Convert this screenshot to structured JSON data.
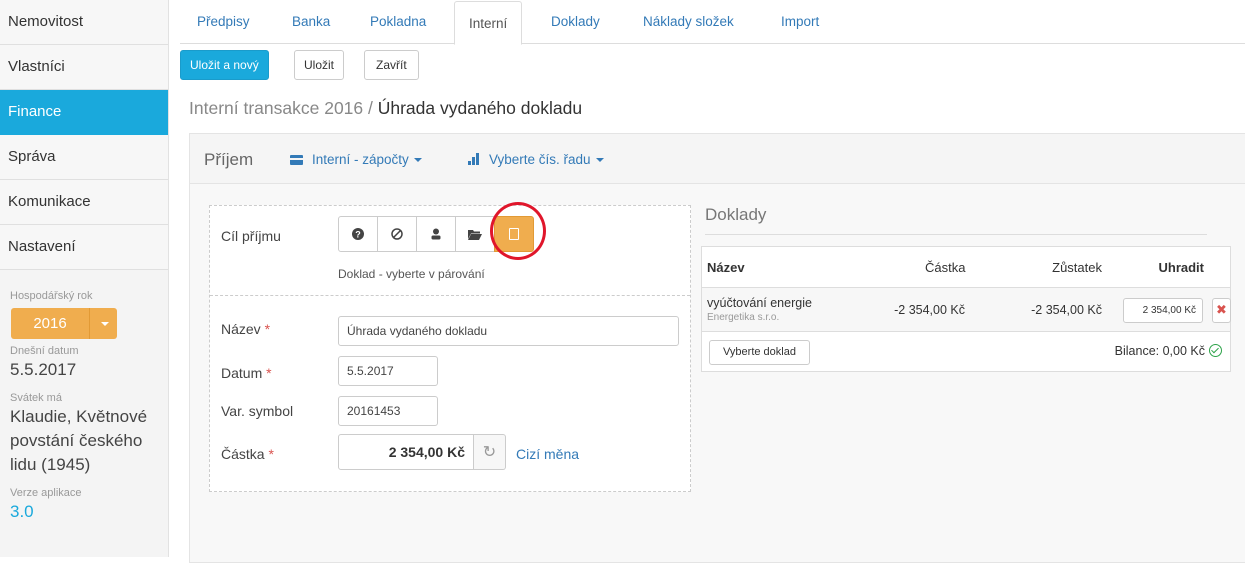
{
  "sidebar": {
    "items": [
      {
        "label": "Nemovitost"
      },
      {
        "label": "Vlastníci"
      },
      {
        "label": "Finance"
      },
      {
        "label": "Správa"
      },
      {
        "label": "Komunikace"
      },
      {
        "label": "Nastavení"
      }
    ],
    "fiscal_year_label": "Hospodářský rok",
    "fiscal_year_value": "2016",
    "today_label": "Dnešní datum",
    "today_value": "5.5.2017",
    "nameday_label": "Svátek má",
    "nameday_value": "Klaudie, Květnové povstání českého lidu (1945)",
    "version_label": "Verze aplikace",
    "version_value": "3.0"
  },
  "tabs": [
    {
      "label": "Předpisy"
    },
    {
      "label": "Banka"
    },
    {
      "label": "Pokladna"
    },
    {
      "label": "Interní"
    },
    {
      "label": "Doklady"
    },
    {
      "label": "Náklady složek"
    },
    {
      "label": "Import"
    }
  ],
  "toolbar": {
    "save_new_label": "Uložit a nový",
    "save_label": "Uložit",
    "close_label": "Zavřít"
  },
  "page_title": {
    "prefix": "Interní transakce 2016 / ",
    "main": "Úhrada vydaného dokladu"
  },
  "panel": {
    "type_label": "Příjem",
    "account_dropdown": "Interní - zápočty",
    "series_dropdown": "Vyberte čís. řadu"
  },
  "form": {
    "target_label": "Cíl příjmu",
    "target_hint": "Doklad - vyberte v párování",
    "target_icons": [
      "question-icon",
      "ban-icon",
      "user-icon",
      "folder-icon",
      "document-icon"
    ],
    "name_label": "Název",
    "name_value": "Úhrada vydaného dokladu",
    "date_label": "Datum",
    "date_value": "5.5.2017",
    "varsym_label": "Var. symbol",
    "varsym_value": "20161453",
    "amount_label": "Částka",
    "amount_value": "2 354,00 Kč",
    "foreign_currency_label": "Cizí měna",
    "required_mark": "*"
  },
  "documents": {
    "title": "Doklady",
    "columns": {
      "name": "Název",
      "amount": "Částka",
      "balance": "Zůstatek",
      "pay": "Uhradit"
    },
    "rows": [
      {
        "name": "vyúčtování energie",
        "company": "Energetika s.r.o.",
        "amount": "-2 354,00 Kč",
        "balance": "-2 354,00 Kč",
        "pay": "2 354,00 Kč"
      }
    ],
    "select_button": "Vyberte doklad",
    "balance_summary": "Bilance: 0,00 Kč"
  },
  "colors": {
    "accent": "#1aa9dc",
    "warning": "#f0ad4e",
    "link": "#337ab7",
    "danger": "#d9534f",
    "success": "#2ea34a",
    "highlight_ring": "#e0162b"
  }
}
